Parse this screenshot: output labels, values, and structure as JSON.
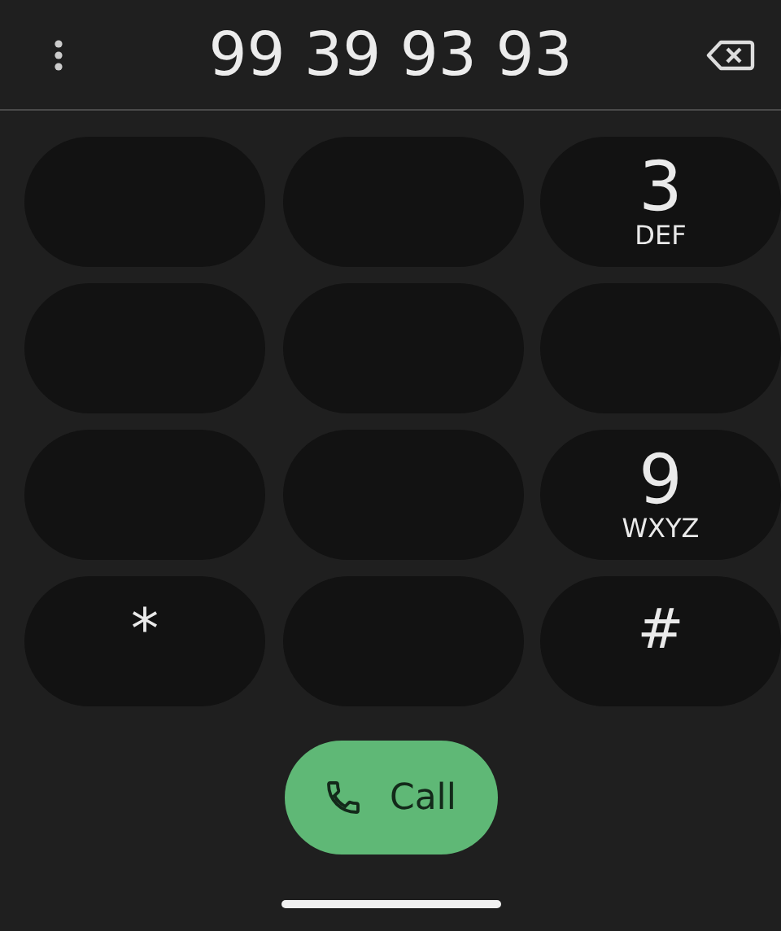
{
  "dialer": {
    "number": "99 39 93 93"
  },
  "keys": [
    {
      "kind": "blank"
    },
    {
      "kind": "blank"
    },
    {
      "kind": "digit",
      "digit": "3",
      "letters": "DEF"
    },
    {
      "kind": "blank"
    },
    {
      "kind": "blank"
    },
    {
      "kind": "blank"
    },
    {
      "kind": "blank"
    },
    {
      "kind": "blank"
    },
    {
      "kind": "digit",
      "digit": "9",
      "letters": "WXYZ"
    },
    {
      "kind": "symbol",
      "digit": "*"
    },
    {
      "kind": "blank"
    },
    {
      "kind": "symbol",
      "digit": "#"
    }
  ],
  "call_button": {
    "label": "Call"
  }
}
